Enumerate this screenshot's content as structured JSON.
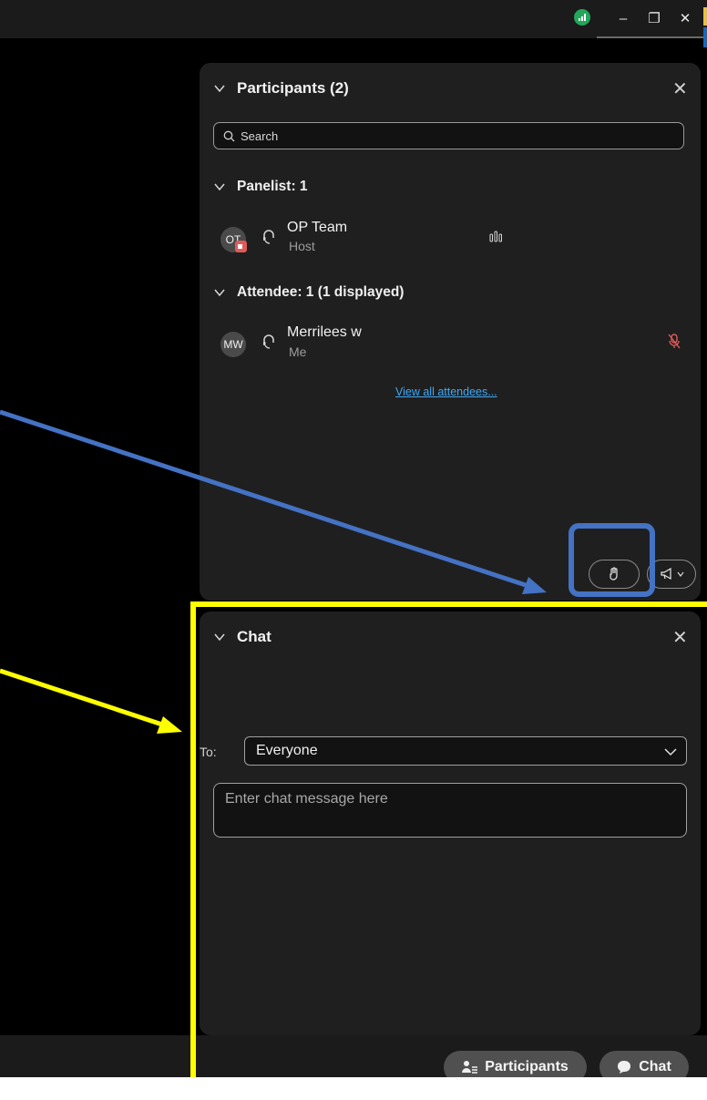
{
  "window": {
    "controls": {
      "minimize": "–",
      "restore": "❐",
      "close": "✕"
    },
    "signal_icon": "signal-bars-icon"
  },
  "participants_panel": {
    "title": "Participants (2)",
    "search_placeholder": "Search",
    "panelist_section": "Panelist: 1",
    "attendee_section": "Attendee: 1 (1 displayed)",
    "members": [
      {
        "initials": "OT",
        "name": "OP Team",
        "role": "Host",
        "status_icon": "audio-level-icon",
        "badge": "recording"
      },
      {
        "initials": "MW",
        "name": "Merrilees w",
        "role": "Me",
        "status_icon": "muted-mic-icon"
      }
    ],
    "view_all": "View all attendees..."
  },
  "chat_panel": {
    "title": "Chat",
    "to_label": "To:",
    "to_value": "Everyone",
    "message_placeholder": "Enter chat message here"
  },
  "bottom_bar": {
    "participants_label": "Participants",
    "chat_label": "Chat"
  },
  "colors": {
    "panel_bg": "#1f1f1f",
    "link": "#3fa9f5",
    "annotation_blue": "#4472c4",
    "annotation_yellow": "#ffff00",
    "muted_red": "#e05a5a"
  }
}
